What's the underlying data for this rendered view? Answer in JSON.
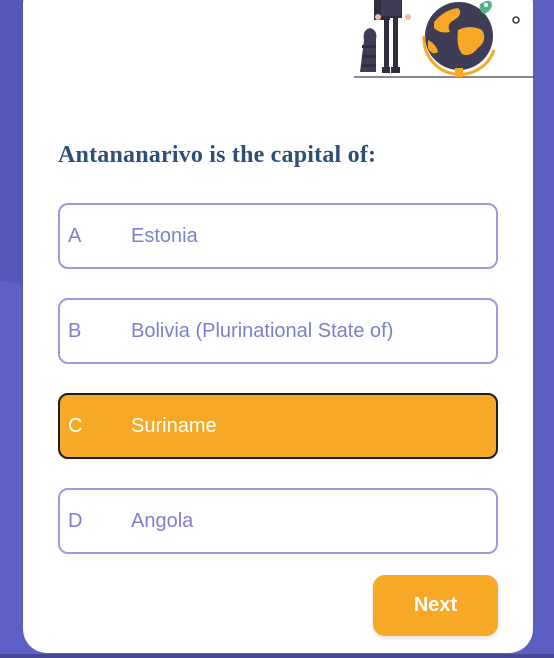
{
  "quiz": {
    "question": "Antananarivo is the capital of:",
    "options": [
      {
        "letter": "A",
        "text": "Estonia",
        "selected": false
      },
      {
        "letter": "B",
        "text": "Bolivia (Plurinational State of)",
        "selected": false
      },
      {
        "letter": "C",
        "text": "Suriname",
        "selected": true
      },
      {
        "letter": "D",
        "text": "Angola",
        "selected": false
      }
    ],
    "next_label": "Next"
  },
  "illustration": {
    "icon": "traveler-with-globe-illustration"
  },
  "colors": {
    "background": "#5d60c4",
    "card": "#ffffff",
    "accent": "#f6a826",
    "option_border": "#9a9be0",
    "option_text": "#7b7fd0",
    "question_text": "#2f4f7a"
  }
}
